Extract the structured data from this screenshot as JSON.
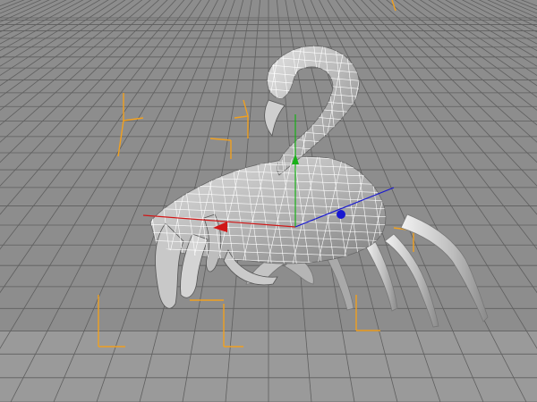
{
  "viewport": {
    "name": "3d-perspective-viewport",
    "background": "#8d8d8d",
    "floor_color": "#9a9a9a",
    "grid_color": "#5f5f5f",
    "wire_color": "#ffffff",
    "mesh_fill": "#b9b9b9",
    "mesh_shade": "#8c8c8c",
    "bbox_color": "#f0a020"
  },
  "model": {
    "subject": "scorpion-mesh",
    "display_mode": "wireframe-on-shaded"
  },
  "gizmo": {
    "x_axis_color": "#d01818",
    "y_axis_color": "#18b018",
    "z_axis_color": "#1818d0"
  }
}
